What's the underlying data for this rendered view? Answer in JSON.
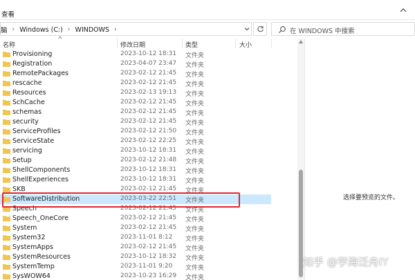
{
  "menu": {
    "view_label": "查看"
  },
  "address": {
    "crumbs": [
      "脑",
      "Windows (C:)",
      "WINDOWS"
    ]
  },
  "search": {
    "placeholder": "在 WINDOWS 中搜索"
  },
  "columns": {
    "name": "名称",
    "modified": "修改日期",
    "type": "类型",
    "size": "大小"
  },
  "rows": [
    {
      "name": "Provisioning",
      "date": "2023-10-12 18:31",
      "type": "文件夹"
    },
    {
      "name": "Registration",
      "date": "2023-04-07 23:47",
      "type": "文件夹"
    },
    {
      "name": "RemotePackages",
      "date": "2023-02-12 21:45",
      "type": "文件夹"
    },
    {
      "name": "rescache",
      "date": "2023-02-12 21:45",
      "type": "文件夹"
    },
    {
      "name": "Resources",
      "date": "2023-02-13 19:13",
      "type": "文件夹"
    },
    {
      "name": "SchCache",
      "date": "2023-02-12 21:45",
      "type": "文件夹"
    },
    {
      "name": "schemas",
      "date": "2023-02-12 21:45",
      "type": "文件夹"
    },
    {
      "name": "security",
      "date": "2023-02-12 21:45",
      "type": "文件夹"
    },
    {
      "name": "ServiceProfiles",
      "date": "2023-02-12 21:50",
      "type": "文件夹"
    },
    {
      "name": "ServiceState",
      "date": "2023-02-12 22:25",
      "type": "文件夹"
    },
    {
      "name": "servicing",
      "date": "2023-10-12 18:31",
      "type": "文件夹"
    },
    {
      "name": "Setup",
      "date": "2023-02-12 21:48",
      "type": "文件夹"
    },
    {
      "name": "ShellComponents",
      "date": "2023-10-12 18:31",
      "type": "文件夹"
    },
    {
      "name": "ShellExperiences",
      "date": "2023-10-12 18:31",
      "type": "文件夹"
    },
    {
      "name": "SKB",
      "date": "2023-02-12 21:45",
      "type": "文件夹"
    },
    {
      "name": "SoftwareDistribution",
      "date": "2023-03-22 22:51",
      "type": "文件夹",
      "selected": true
    },
    {
      "name": "Speech",
      "date": "2023-02-12 21:45",
      "type": "文件夹"
    },
    {
      "name": "Speech_OneCore",
      "date": "2023-02-12 21:45",
      "type": "文件夹"
    },
    {
      "name": "System",
      "date": "2023-02-12 21:45",
      "type": "文件夹"
    },
    {
      "name": "System32",
      "date": "2023-11-01 8:12",
      "type": "文件夹"
    },
    {
      "name": "SystemApps",
      "date": "2023-02-12 21:45",
      "type": "文件夹"
    },
    {
      "name": "SystemResources",
      "date": "2023-10-12 18:32",
      "type": "文件夹"
    },
    {
      "name": "SystemTemp",
      "date": "2023-11-01 9:20",
      "type": "文件夹"
    },
    {
      "name": "SysWOW64",
      "date": "2023-10-23 16:29",
      "type": "文件夹"
    }
  ],
  "preview": {
    "message": "选择要预览的文件。"
  },
  "watermark": "知乎 @学海泛舟IY",
  "colors": {
    "folder": "#f0c550",
    "selection": "#cce8ff",
    "highlight": "#e0252b"
  }
}
